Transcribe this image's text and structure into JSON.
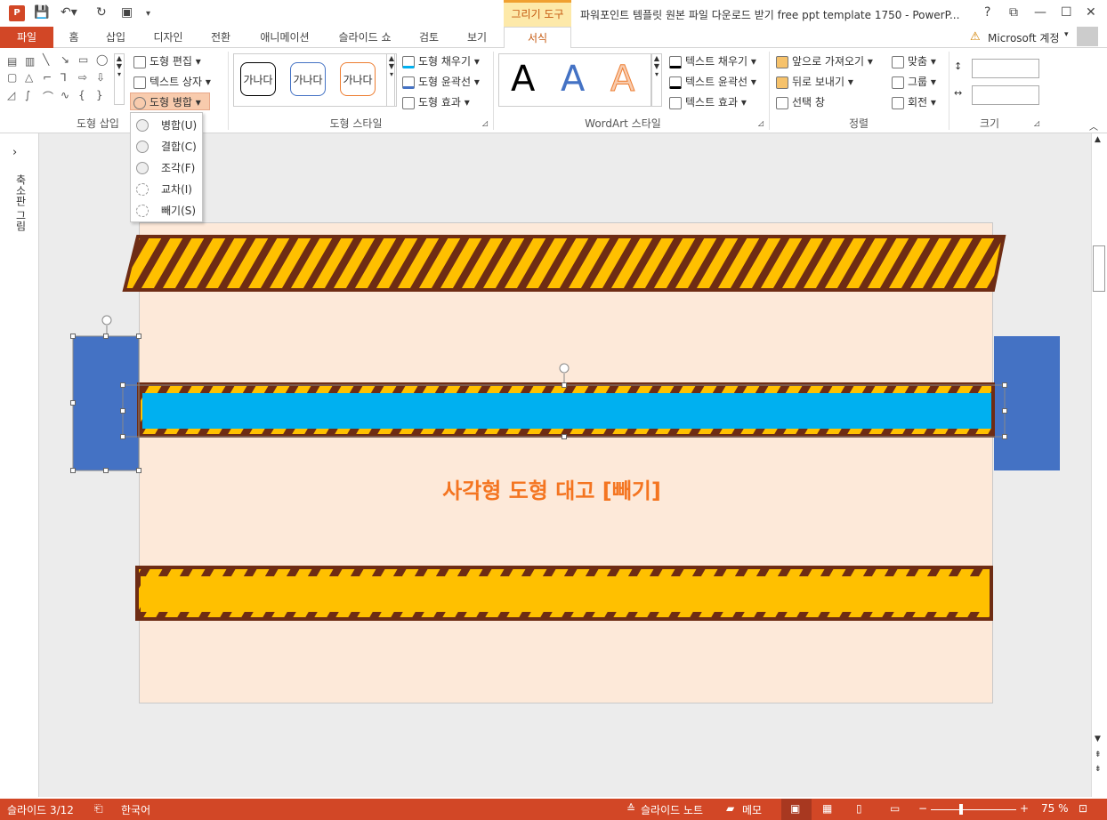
{
  "titlebar": {
    "app_icon": "P",
    "contextual_group": "그리기 도구",
    "window_title": "파워포인트 템플릿 원본 파일 다운로드 받기 free ppt template 1750 - PowerP...",
    "help": "?",
    "restore_ribbon": "⧉",
    "minimize": "—",
    "maximize": "☐",
    "close": "✕"
  },
  "tabs": {
    "file": "파일",
    "items": [
      "홈",
      "삽입",
      "디자인",
      "전환",
      "애니메이션",
      "슬라이드 쇼",
      "검토",
      "보기"
    ],
    "format": "서식",
    "account": "Microsoft 계정"
  },
  "ribbon": {
    "insert_shapes": {
      "label": "도형 삽입",
      "edit_shape": "도형 편집",
      "text_box": "텍스트 상자",
      "merge_shapes": "도형 병합"
    },
    "shape_styles": {
      "label": "도형 스타일",
      "samples": [
        "가나다",
        "가나다",
        "가나다"
      ],
      "fill": "도형 채우기",
      "outline": "도형 윤곽선",
      "effects": "도형 효과"
    },
    "wordart_styles": {
      "label": "WordArt 스타일",
      "samples": [
        "A",
        "A",
        "A"
      ],
      "text_fill": "텍스트 채우기",
      "text_outline": "텍스트 윤곽선",
      "text_effects": "텍스트 효과"
    },
    "arrange": {
      "label": "정렬",
      "bring_forward": "앞으로 가져오기",
      "send_backward": "뒤로 보내기",
      "selection_pane": "선택 창",
      "align": "맞춤",
      "group": "그룹",
      "rotate": "회전"
    },
    "size": {
      "label": "크기"
    }
  },
  "merge_menu": [
    {
      "label": "병합(U)"
    },
    {
      "label": "결합(C)"
    },
    {
      "label": "조각(F)"
    },
    {
      "label": "교차(I)"
    },
    {
      "label": "빼기(S)"
    }
  ],
  "thumb_pane": {
    "expand": "›",
    "label": "축소판 그림"
  },
  "slide": {
    "caption": "사각형 도형 대고 [빼기]"
  },
  "status": {
    "slide_number": "슬라이드 3/12",
    "language": "한국어",
    "notes": "슬라이드 노트",
    "comments": "메모",
    "zoom": "75 %"
  },
  "colors": {
    "accent": "#d24726",
    "stripe_yellow": "#ffc000",
    "stripe_brown": "#6e2c14",
    "blue_fill": "#00b0f0",
    "side_blue": "#4472c4",
    "caption": "#f47521"
  }
}
